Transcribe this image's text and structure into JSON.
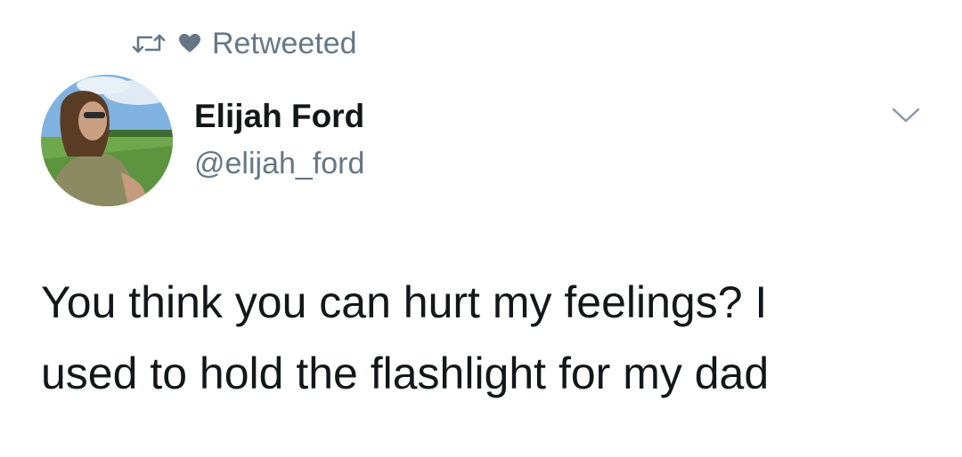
{
  "context": {
    "label": "Retweeted",
    "retweet_icon": "retweet-icon",
    "like_icon": "heart-icon"
  },
  "author": {
    "name": "Elijah Ford",
    "handle": "@elijah_ford"
  },
  "tweet": {
    "lines": [
      "You think you can hurt my feelings? I",
      "used to hold the flashlight for my dad"
    ]
  },
  "menu_icon": "chevron-down-icon",
  "colors": {
    "text": "#14171a",
    "secondary": "#657786",
    "background": "#ffffff"
  }
}
